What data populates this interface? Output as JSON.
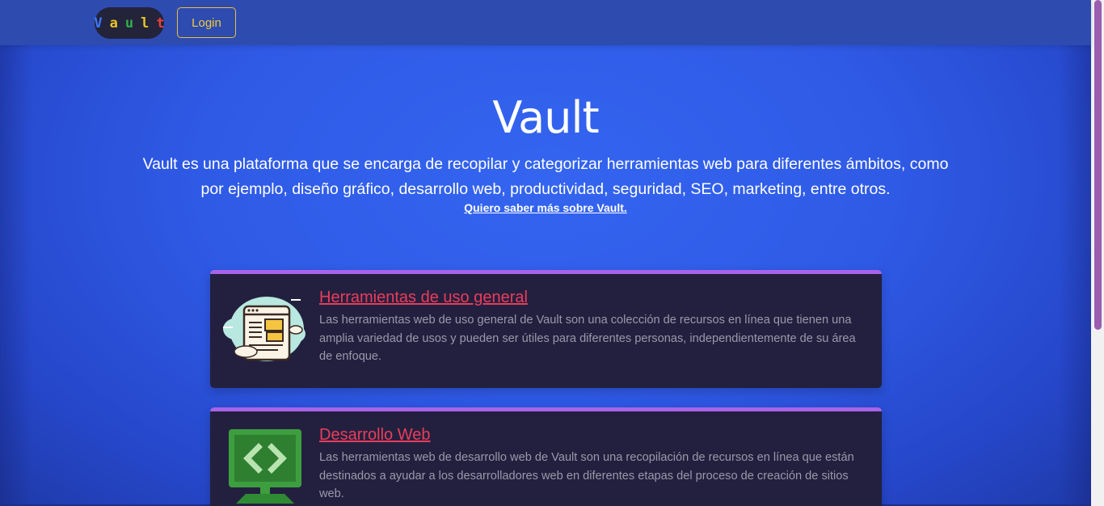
{
  "navbar": {
    "logo_letters": [
      {
        "char": "V",
        "color": "#3b78ff"
      },
      {
        "char": "a",
        "color": "#e8c42a"
      },
      {
        "char": "u",
        "color": "#2fb14a"
      },
      {
        "char": "l",
        "color": "#e8c42a"
      },
      {
        "char": "t",
        "color": "#e6423a"
      }
    ],
    "login_label": "Login"
  },
  "hero": {
    "title": "Vault",
    "description": "Vault es una plataforma que se encarga de recopilar y categorizar herramientas web para diferentes ámbitos, como por ejemplo, diseño gráfico, desarrollo web, productividad, seguridad, SEO, marketing, entre otros.",
    "link_text": "Quiero saber más sobre Vault."
  },
  "cards": [
    {
      "title": "Herramientas de uso general",
      "text": "Las herramientas web de uso general de Vault son una colección de recursos en línea que tienen una amplia variedad de usos y pueden ser útiles para diferentes personas, independientemente de su área de enfoque.",
      "icon": "web-browser-cloud-icon"
    },
    {
      "title": "Desarrollo Web",
      "text": "Las herramientas web de desarrollo web de Vault son una recopilación de recursos en línea que están destinados a ayudar a los desarrolladores web en diferentes etapas del proceso de creación de sitios web.",
      "icon": "code-monitor-icon"
    }
  ],
  "colors": {
    "accent_border": "#a764e8",
    "card_title": "#ea3d5a",
    "login_border": "#e8c23a",
    "background": "#2f5be6"
  }
}
